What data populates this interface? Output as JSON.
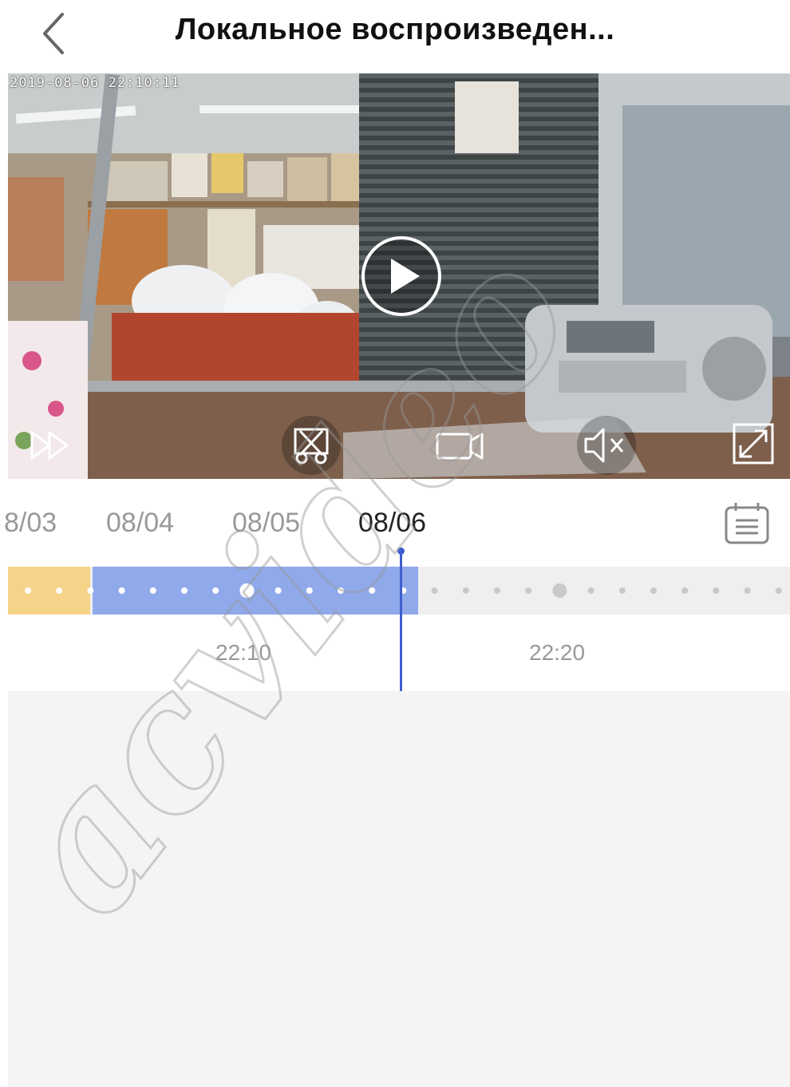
{
  "header": {
    "title": "Локальное воспроизведен..."
  },
  "video": {
    "timestamp": "2019-08-06  22:10:11"
  },
  "dates": [
    {
      "label": "8/03",
      "active": false
    },
    {
      "label": "08/04",
      "active": false
    },
    {
      "label": "08/05",
      "active": false
    },
    {
      "label": "08/06",
      "active": true
    }
  ],
  "timeline": {
    "ticks": [
      "22:10",
      "22:20"
    ]
  },
  "icons": [
    "back-icon",
    "play-icon",
    "fast-forward-icon",
    "scissors-icon",
    "record-icon",
    "mute-icon",
    "fullscreen-icon",
    "calendar-icon"
  ],
  "watermark": "acvideo",
  "colors": {
    "accent": "#3f5fcf",
    "recorded_blue": "#90a9ea",
    "recorded_yellow": "#f5d48a"
  }
}
